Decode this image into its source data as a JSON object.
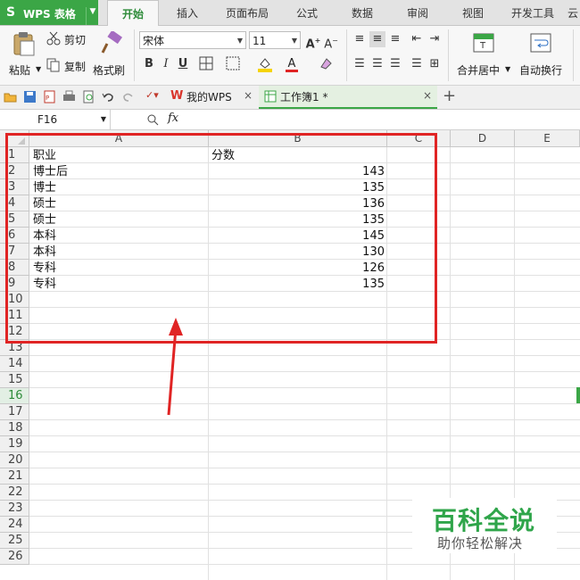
{
  "menubar": {
    "app_name": "WPS 表格",
    "tabs": [
      "开始",
      "插入",
      "页面布局",
      "公式",
      "数据",
      "审阅",
      "视图",
      "开发工具",
      "云"
    ]
  },
  "ribbon": {
    "paste": "粘贴",
    "cut": "剪切",
    "copy": "复制",
    "format_painter": "格式刷",
    "font_name": "宋体",
    "font_size": "11",
    "merge_center": "合并居中",
    "wrap_text": "自动换行",
    "bold": "B",
    "italic": "I",
    "underline": "U"
  },
  "doctabs": {
    "home": "我的WPS",
    "workbook": "工作簿1 *"
  },
  "formula_bar": {
    "cell_ref": "F16",
    "fx": "fx"
  },
  "sheet": {
    "columns": [
      "A",
      "B",
      "C",
      "D",
      "E"
    ],
    "rows": [
      "1",
      "2",
      "3",
      "4",
      "5",
      "6",
      "7",
      "8",
      "9",
      "10",
      "11",
      "12",
      "13",
      "14",
      "15",
      "16",
      "17",
      "18",
      "19",
      "20",
      "21",
      "22",
      "23",
      "24",
      "25",
      "26"
    ],
    "selected_row": "16",
    "a_values": [
      "职业",
      "博士后",
      "博士",
      "硕士",
      "硕士",
      "本科",
      "本科",
      "专科",
      "专科"
    ],
    "b_values": [
      "分数",
      "143",
      "135",
      "136",
      "135",
      "145",
      "130",
      "126",
      "135"
    ]
  },
  "watermark": {
    "title": "百科全说",
    "subtitle": "助你轻松解决"
  },
  "colors": {
    "accent_green": "#3ba646",
    "highlight_red": "#e02424"
  }
}
